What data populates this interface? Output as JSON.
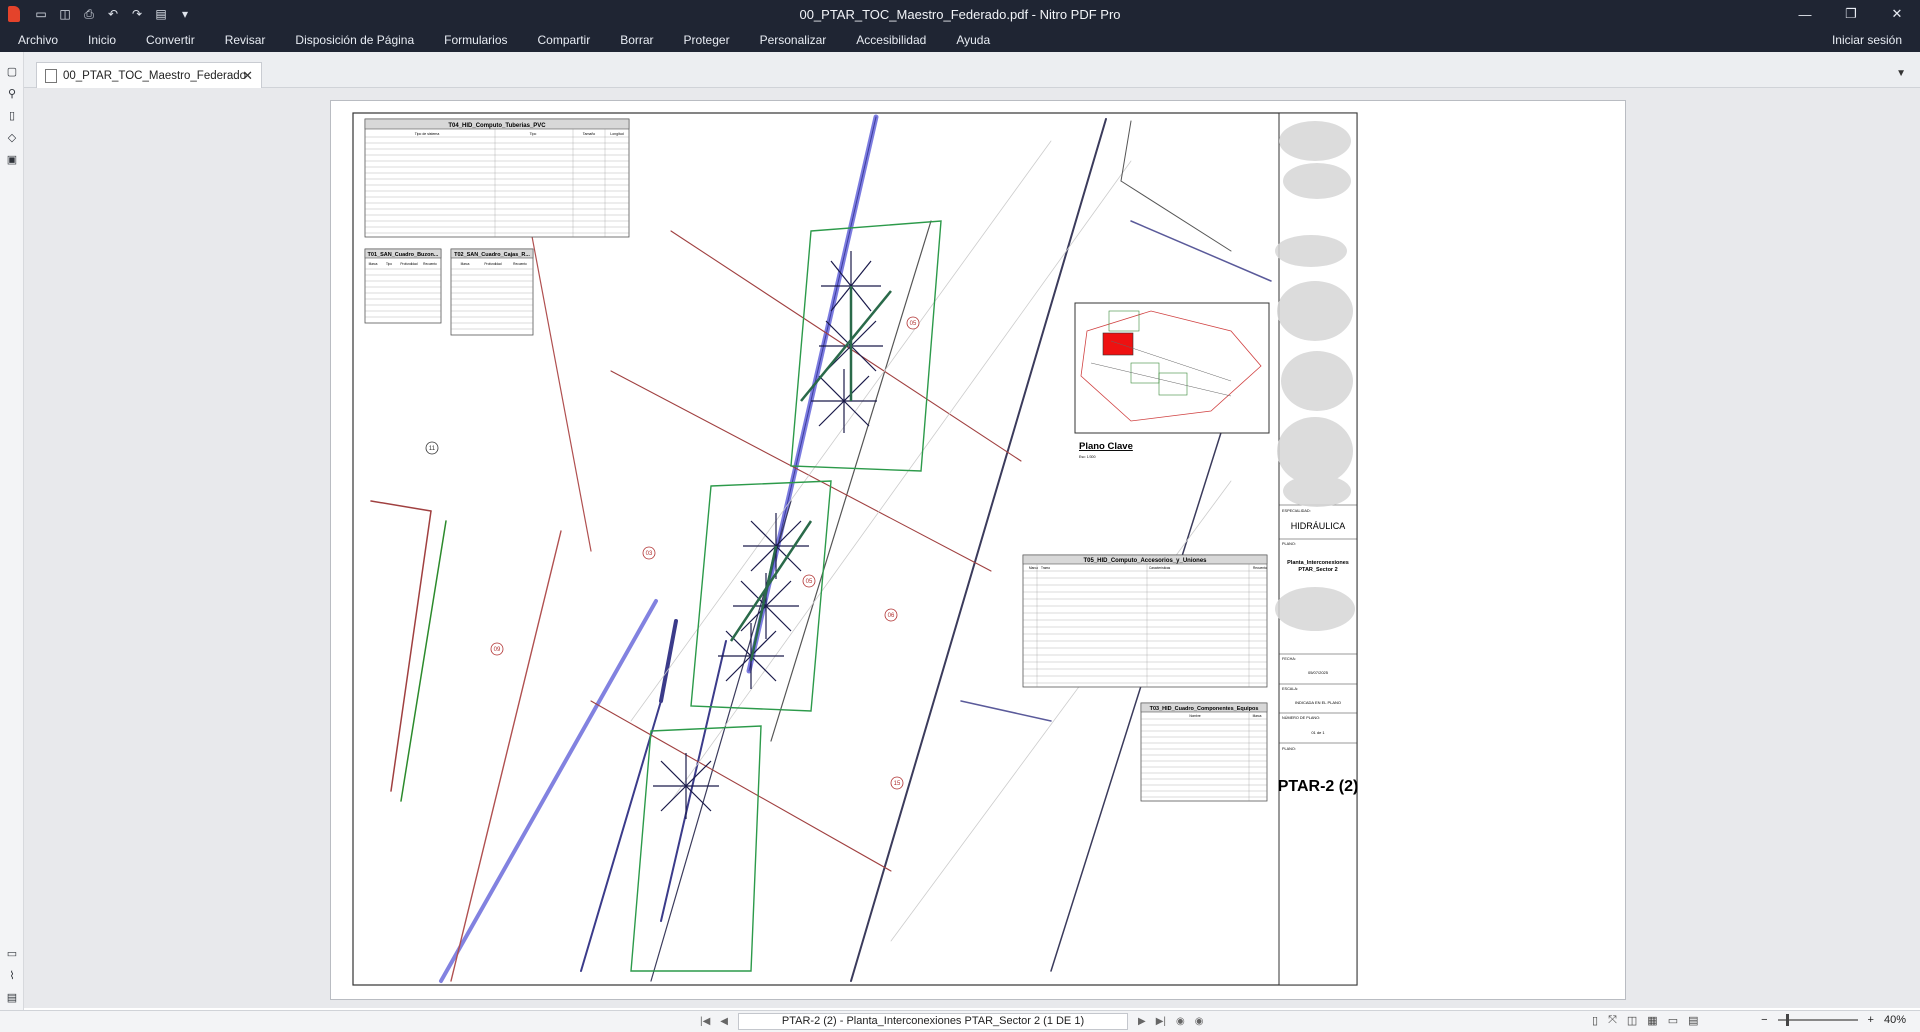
{
  "app": {
    "window_title": "00_PTAR_TOC_Maestro_Federado.pdf - Nitro PDF Pro",
    "menu": [
      "Archivo",
      "Inicio",
      "Convertir",
      "Revisar",
      "Disposición de Página",
      "Formularios",
      "Compartir",
      "Borrar",
      "Proteger",
      "Personalizar",
      "Accesibilidad",
      "Ayuda"
    ],
    "signin": "Iniciar sesión",
    "tab_label": "00_PTAR_TOC_Maestro_Federado",
    "icons": {
      "logo": "nitro-logo-icon",
      "quick_access": [
        "open-folder-icon",
        "save-icon",
        "print-icon",
        "undo-icon",
        "redo-icon",
        "page-icon",
        "more-icon"
      ],
      "left_rail": [
        "pages-icon",
        "search-icon",
        "bookmark-icon",
        "tag-icon",
        "lock-icon",
        "comments-icon",
        "attachments-icon",
        "layers-icon"
      ]
    }
  },
  "status": {
    "page_label": "PTAR-2 (2) - Planta_Interconexiones PTAR_Sector 2  (1 DE 1)",
    "zoom": "40%"
  },
  "drawing": {
    "table_t04_title": "T04_HID_Computo_Tuberias_PVC",
    "table_t04_headers": [
      "Tipo de sistema",
      "Tipo",
      "Tamaño",
      "Longitud"
    ],
    "table_t01_title": "T01_SAN_Cuadro_Buzon...",
    "table_t01_headers": [
      "Marca",
      "Tipo",
      "Profundidad",
      "Recuento"
    ],
    "table_t02_title": "T02_SAN_Cuadro_Cajas_R...",
    "table_t02_headers": [
      "Marca",
      "Profundidad",
      "Recuento"
    ],
    "key_plan_title": "Plano Clave",
    "key_plan_scale": "Esc: 1/300",
    "table_t05_title": "T05_HID_Computo_Accesorios_y_Uniones",
    "table_t05_headers": [
      "Marca",
      "Tramo",
      "Características",
      "Recuento"
    ],
    "table_t03_title": "T03_HID_Cuadro_Componentes_Equipos",
    "table_t03_headers": [
      "Nombre",
      "Marca"
    ],
    "title_block": {
      "specialty_label": "ESPECIALIDAD:",
      "specialty": "HIDRÁULICA",
      "plan_label": "PLANO:",
      "plan_name_1": "Planta_Interconexiones",
      "plan_name_2": "PTAR_Sector 2",
      "date_label": "FECHA:",
      "date": "05/07/2025",
      "scale_label": "ESCALA:",
      "scale": "INDICADA EN EL PLANO",
      "sheet_no_label": "NÚMERO DE PLANO:",
      "sheet_no": "01 de 1",
      "sheet_label": "PLANO:",
      "sheet_code": "PTAR-2 (2)"
    },
    "callouts": [
      "05",
      "05",
      "03",
      "06",
      "09",
      "11",
      "15"
    ]
  }
}
